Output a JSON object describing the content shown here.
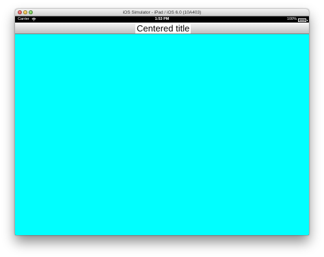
{
  "window": {
    "title": "iOS Simulator - iPad / iOS 6.0 (10A403)"
  },
  "status_bar": {
    "carrier": "Carrier",
    "time": "1:53 PM",
    "battery_percent": "100%"
  },
  "navigation_bar": {
    "title": "Centered title"
  },
  "colors": {
    "content_background": "#00ffff",
    "status_bar_background": "#000000"
  }
}
